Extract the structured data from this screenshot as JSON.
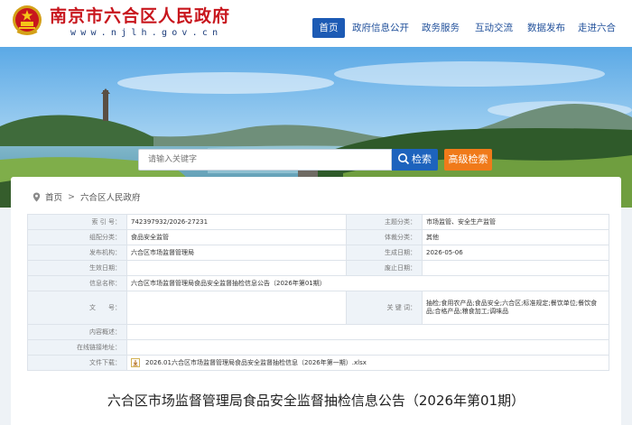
{
  "header": {
    "site_title": "南京市六合区人民政府",
    "site_url": "www.njlh.gov.cn"
  },
  "nav": {
    "items": [
      {
        "label": "首页",
        "active": true
      },
      {
        "label": "政府信息公开",
        "active": false
      },
      {
        "label": "政务服务",
        "active": false
      },
      {
        "label": "互动交流",
        "active": false
      },
      {
        "label": "数据发布",
        "active": false
      },
      {
        "label": "走进六合",
        "active": false
      }
    ]
  },
  "search": {
    "placeholder": "请输入关键字",
    "button_label": "检索",
    "advanced_label": "高级检索"
  },
  "breadcrumb": {
    "home": "首页",
    "current": "六合区人民政府"
  },
  "info": {
    "index_no_label": "索 引 号：",
    "index_no": "742397932/2026-27231",
    "topic_label": "主题分类：",
    "topic": "市场监管、安全生产监管",
    "org_category_label": "组配分类：",
    "org_category": "食品安全监管",
    "genre_label": "体裁分类：",
    "genre": "其他",
    "publisher_label": "发布机构：",
    "publisher": "六合区市场监督管理局",
    "created_label": "生成日期：",
    "created": "2026-05-06",
    "effective_label": "生效日期：",
    "effective": "",
    "abolished_label": "废止日期：",
    "abolished": "",
    "info_name_label": "信息名称：",
    "info_name": "六合区市场监督管理局食品安全监督抽检信息公告（2026年第01期）",
    "doc_no_label": "文　　号：",
    "doc_no": "",
    "keywords_label": "关 键 词：",
    "keywords": "抽检;食用农产品;食品安全;六合区;标准规定;餐饮单位;餐饮食品;合格产品;粮食加工;调味品",
    "summary_label": "内容概述：",
    "summary": "",
    "online_link_label": "在线链接地址：",
    "online_link": "",
    "attachment_label": "文件下载：",
    "attachment": "2026.01六合区市场监督管理局食品安全监督抽检信息（2026年第一期）.xlsx"
  },
  "document": {
    "title": "六合区市场监督管理局食品安全监督抽检信息公告（2026年第01期）"
  },
  "colors": {
    "brand_red": "#c8161d",
    "nav_blue": "#1c5ab4",
    "search_blue": "#1d63bd",
    "advanced_orange": "#f07a1a"
  }
}
